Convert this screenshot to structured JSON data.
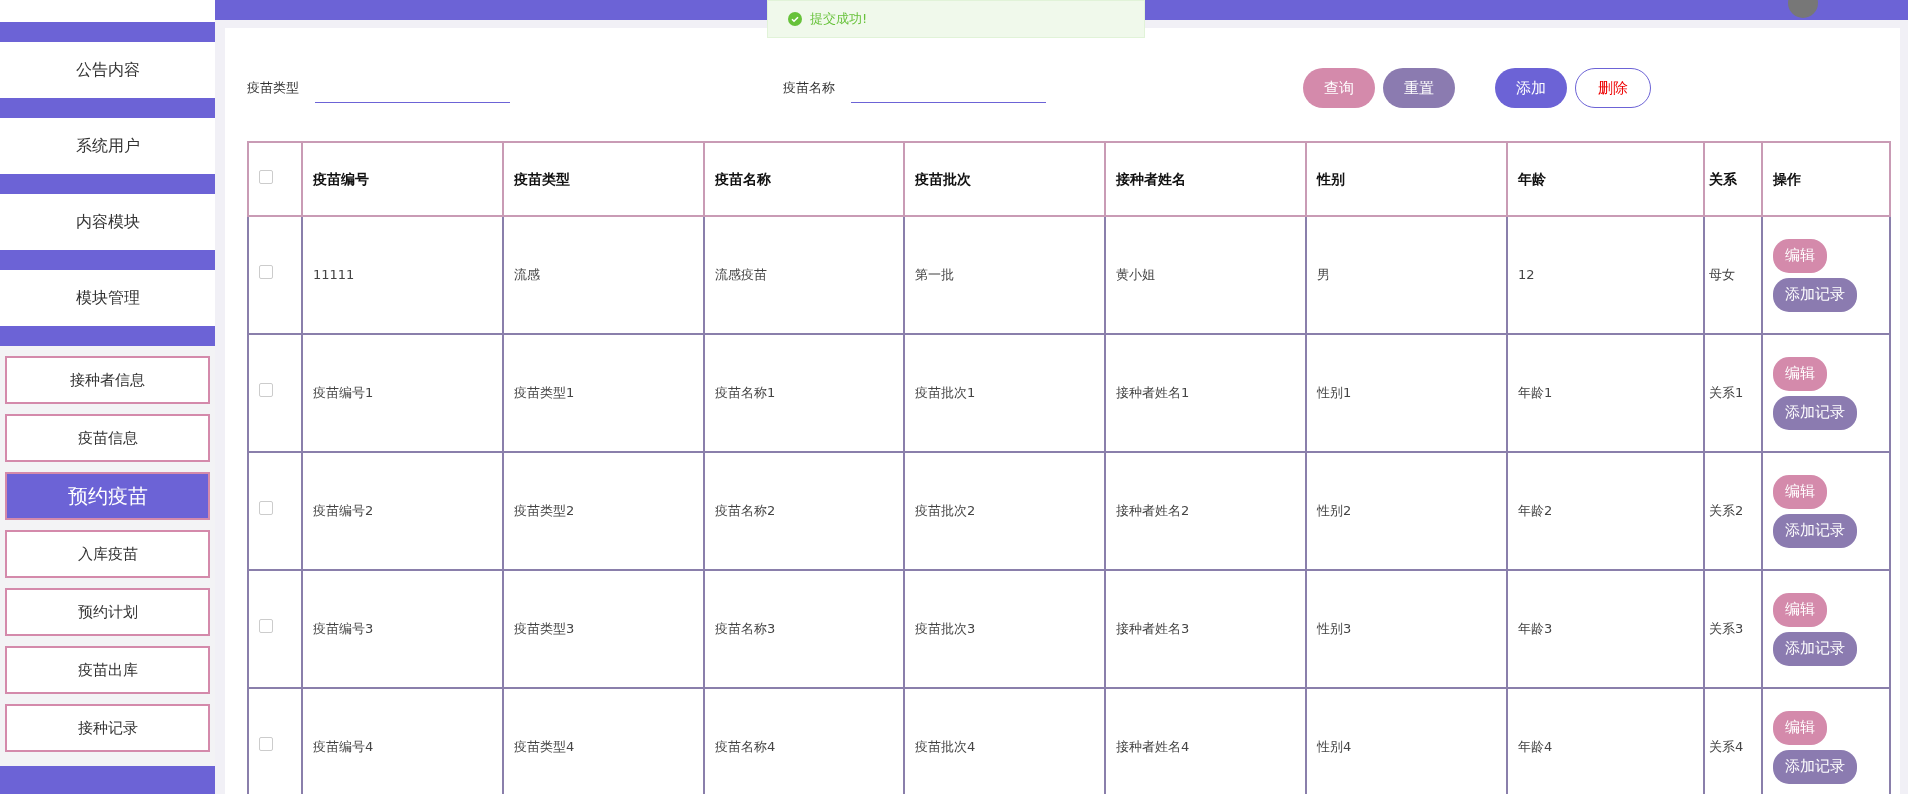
{
  "sidebar": {
    "menu": [
      {
        "label": "公告内容",
        "selected": false
      },
      {
        "label": "系统用户",
        "selected": false
      },
      {
        "label": "内容模块",
        "selected": false
      },
      {
        "label": "模块管理",
        "selected": false
      }
    ],
    "submenu": [
      {
        "label": "接种者信息",
        "selected": false
      },
      {
        "label": "疫苗信息",
        "selected": false
      },
      {
        "label": "预约疫苗",
        "selected": true
      },
      {
        "label": "入库疫苗",
        "selected": false
      },
      {
        "label": "预约计划",
        "selected": false
      },
      {
        "label": "疫苗出库",
        "selected": false
      },
      {
        "label": "接种记录",
        "selected": false
      }
    ]
  },
  "toast": {
    "message": "提交成功!"
  },
  "filters": [
    {
      "label": "疫苗类型"
    },
    {
      "label": "疫苗名称"
    }
  ],
  "buttons": [
    {
      "label": "查询",
      "kind": "query"
    },
    {
      "label": "重置",
      "kind": "reset"
    },
    {
      "label": "添加",
      "kind": "add"
    },
    {
      "label": "删除",
      "kind": "delete"
    }
  ],
  "table": {
    "header_checked": false,
    "columns": [
      "疫苗编号",
      "疫苗类型",
      "疫苗名称",
      "疫苗批次",
      "接种者姓名",
      "性别",
      "年龄",
      "关系",
      "操作"
    ],
    "rows": [
      {
        "checked": false,
        "cells": [
          "11111",
          "流感",
          "流感疫苗",
          "第一批",
          "黄小姐",
          "男",
          "12",
          "母女"
        ],
        "actions": [
          "编辑",
          "添加记录"
        ]
      },
      {
        "checked": false,
        "cells": [
          "疫苗编号1",
          "疫苗类型1",
          "疫苗名称1",
          "疫苗批次1",
          "接种者姓名1",
          "性别1",
          "年龄1",
          "关系1"
        ],
        "actions": [
          "编辑",
          "添加记录"
        ]
      },
      {
        "checked": false,
        "cells": [
          "疫苗编号2",
          "疫苗类型2",
          "疫苗名称2",
          "疫苗批次2",
          "接种者姓名2",
          "性别2",
          "年龄2",
          "关系2"
        ],
        "actions": [
          "编辑",
          "添加记录"
        ]
      },
      {
        "checked": false,
        "cells": [
          "疫苗编号3",
          "疫苗类型3",
          "疫苗名称3",
          "疫苗批次3",
          "接种者姓名3",
          "性别3",
          "年龄3",
          "关系3"
        ],
        "actions": [
          "编辑",
          "添加记录"
        ]
      },
      {
        "checked": false,
        "cells": [
          "疫苗编号4",
          "疫苗类型4",
          "疫苗名称4",
          "疫苗批次4",
          "接种者姓名4",
          "性别4",
          "年龄4",
          "关系4"
        ],
        "actions": [
          "编辑",
          "添加记录"
        ]
      }
    ]
  }
}
